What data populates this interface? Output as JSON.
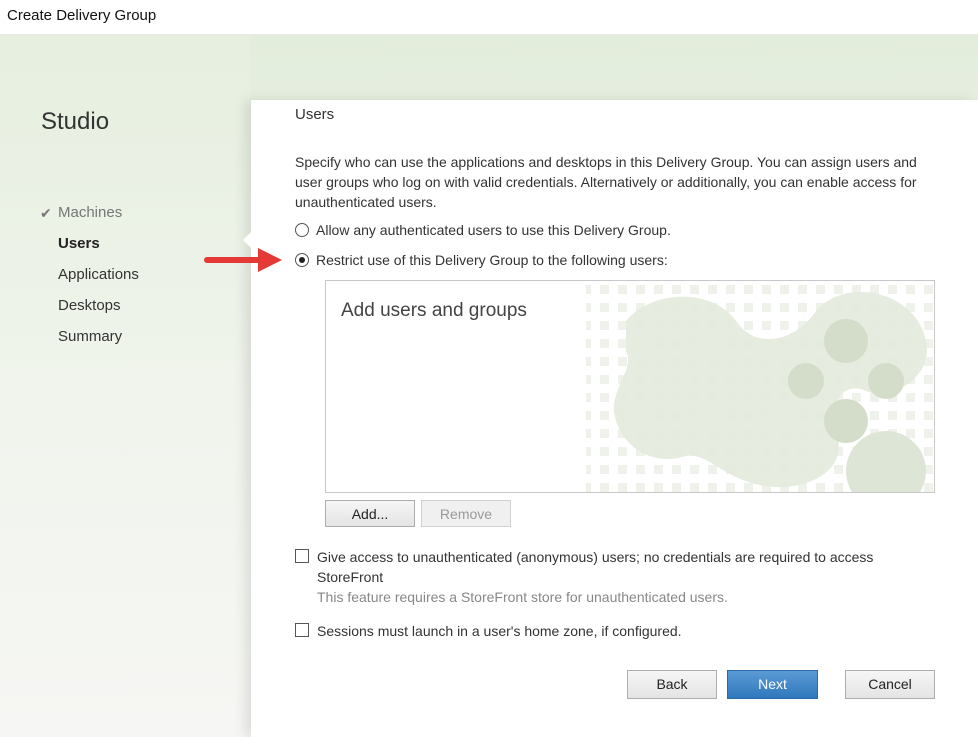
{
  "window": {
    "title": "Create Delivery Group"
  },
  "sidebar": {
    "brand": "Studio",
    "items": [
      {
        "label": "Machines",
        "state": "done",
        "check": "✔"
      },
      {
        "label": "Users",
        "state": "active"
      },
      {
        "label": "Applications",
        "state": "pending"
      },
      {
        "label": "Desktops",
        "state": "pending"
      },
      {
        "label": "Summary",
        "state": "pending"
      }
    ]
  },
  "main": {
    "section_title": "Users",
    "description": "Specify who can use the applications and desktops in this Delivery Group. You can assign users and user groups who log on with valid credentials. Alternatively or additionally, you can enable access for unauthenticated users.",
    "radio_any": {
      "label": "Allow any authenticated users to use this Delivery Group.",
      "checked": false
    },
    "radio_restrict": {
      "label": "Restrict use of this Delivery Group to the following users:",
      "checked": true
    },
    "users_box": {
      "placeholder": "Add users and groups"
    },
    "add_button": "Add...",
    "remove_button": "Remove",
    "checkbox_unauth": {
      "label": "Give access to unauthenticated (anonymous) users; no credentials are required to access StoreFront",
      "checked": false,
      "note": "This feature requires a StoreFront store for unauthenticated users."
    },
    "checkbox_home_zone": {
      "label": "Sessions must launch in a user's home zone, if configured.",
      "checked": false
    }
  },
  "footer": {
    "back": "Back",
    "next": "Next",
    "cancel": "Cancel"
  },
  "colors": {
    "accent": "#2f78bd",
    "annotation_arrow": "#e53935"
  }
}
